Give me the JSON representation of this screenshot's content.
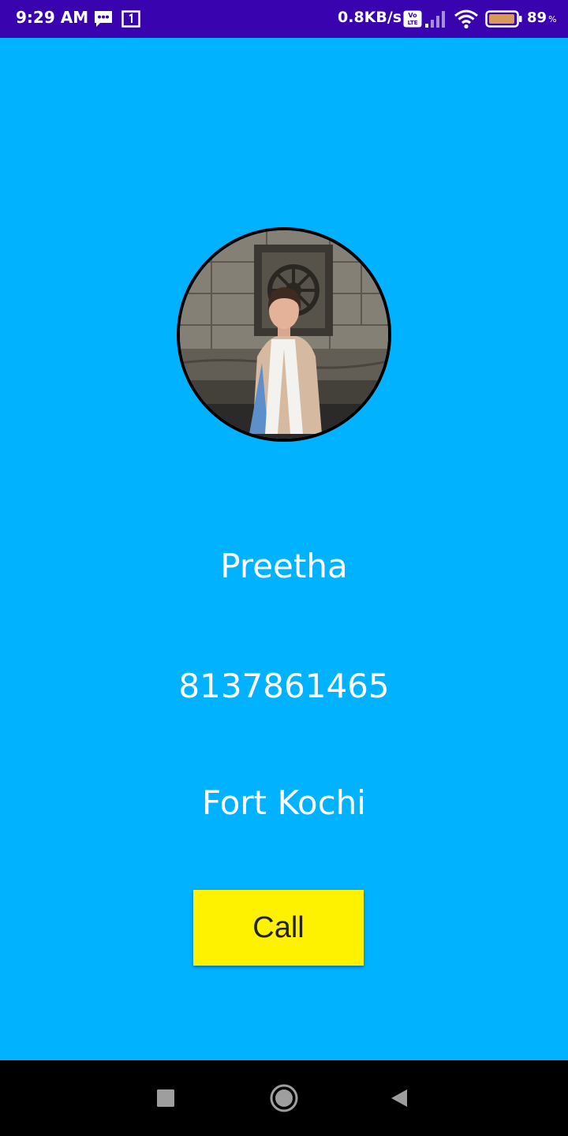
{
  "status_bar": {
    "time": "9:29 AM",
    "network_speed": "0.8KB/s",
    "battery_percent": "89",
    "battery_unit": "%",
    "icons": [
      "message-icon",
      "sim-notification-icon",
      "volte-icon",
      "signal-icon",
      "wifi-icon",
      "battery-icon"
    ]
  },
  "contact": {
    "name": "Preetha",
    "phone": "8137861465",
    "location": "Fort Kochi"
  },
  "actions": {
    "call_label": "Call"
  },
  "nav_bar": {
    "buttons": [
      "recents-button",
      "home-button",
      "back-button"
    ]
  },
  "colors": {
    "status_bar": "#3a03b0",
    "background": "#00b2ff",
    "call_button": "#fff200",
    "nav_bar": "#000000"
  }
}
